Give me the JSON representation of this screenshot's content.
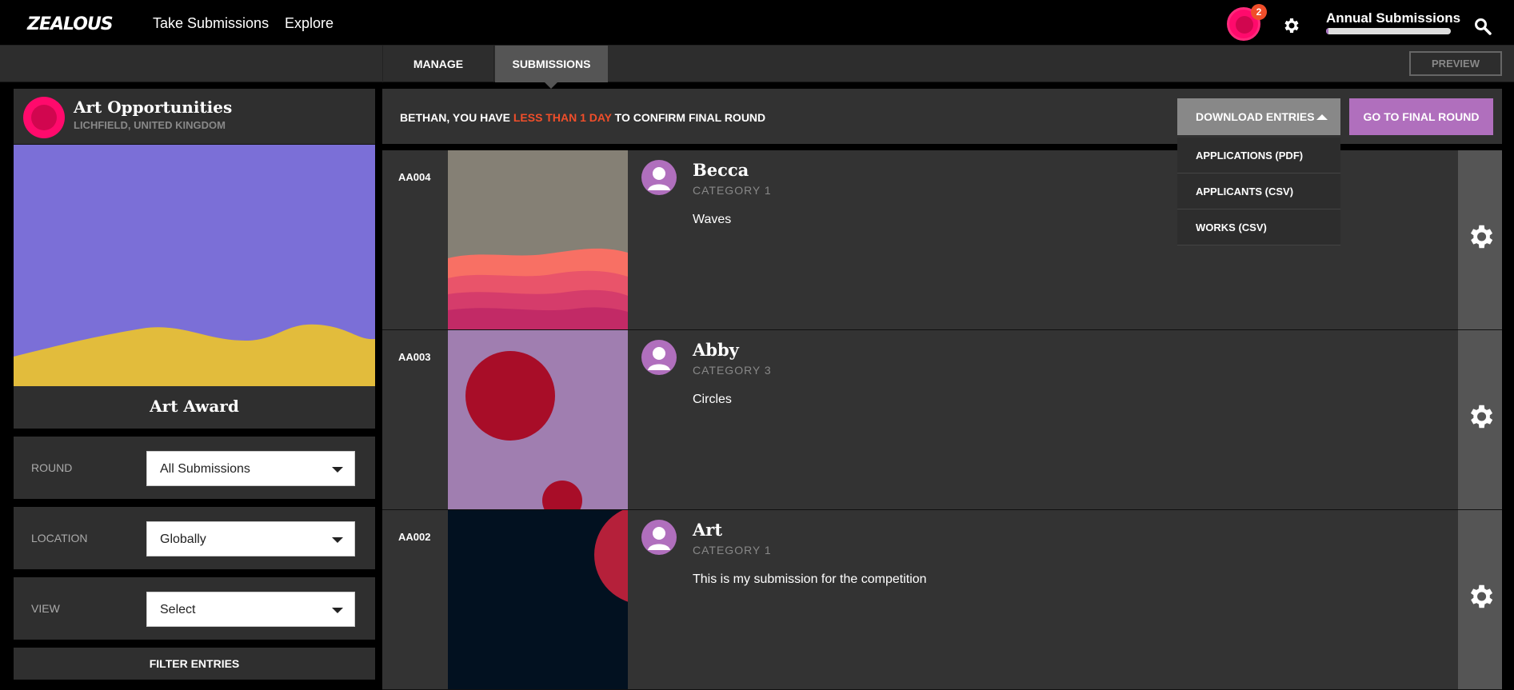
{
  "header": {
    "logo": "ZEALOUS",
    "nav": [
      "Take Submissions",
      "Explore"
    ],
    "notification_count": "2",
    "project_title": "Annual Submissions",
    "progress": 0.02
  },
  "tabs": [
    "MANAGE",
    "SUBMISSIONS"
  ],
  "preview_label": "PREVIEW",
  "organization": {
    "name": "Art Opportunities",
    "location": "LICHFIELD, UNITED KINGDOM",
    "award": "Art Award"
  },
  "filters": [
    {
      "label": "ROUND",
      "value": "All Submissions"
    },
    {
      "label": "LOCATION",
      "value": "Globally"
    },
    {
      "label": "VIEW",
      "value": "Select"
    }
  ],
  "filter_button": "FILTER ENTRIES",
  "banner": {
    "prefix": "BETHAN, YOU HAVE",
    "highlight": "LESS THAN 1 DAY",
    "suffix": "TO CONFIRM FINAL ROUND",
    "download_label": "DOWNLOAD ENTRIES",
    "final_label": "GO TO FINAL ROUND"
  },
  "download_menu": [
    "APPLICATIONS (PDF)",
    "APPLICANTS (CSV)",
    "WORKS (CSV)"
  ],
  "entries": [
    {
      "id": "AA004",
      "name": "Becca",
      "category": "CATEGORY 1",
      "title": "Waves"
    },
    {
      "id": "AA003",
      "name": "Abby",
      "category": "CATEGORY 3",
      "title": "Circles"
    },
    {
      "id": "AA002",
      "name": "Art",
      "category": "CATEGORY 1",
      "title": "This is my submission for the competition"
    }
  ],
  "colors": {
    "accent_pink": "#ff0a6c",
    "purple": "#b06fbd",
    "alert": "#f04e2a"
  }
}
